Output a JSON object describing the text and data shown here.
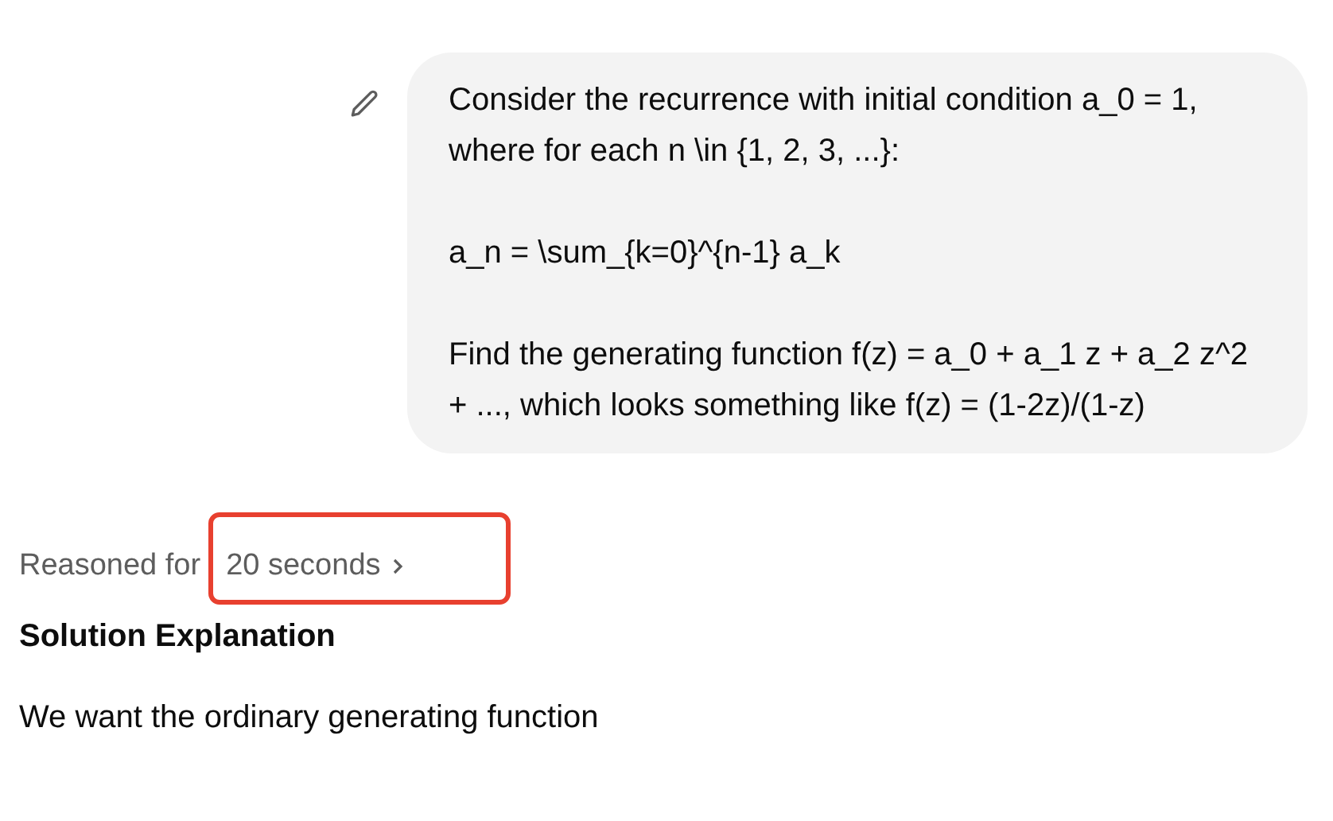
{
  "user_message": {
    "paragraphs": [
      "Consider the recurrence with initial condition a_0 = 1, where for each n \\in {1, 2, 3, ...}:",
      "a_n = \\sum_{k=0}^{n-1} a_k",
      "Find the generating function f(z) = a_0 + a_1 z + a_2 z^2 + ..., which looks something like f(z) = (1-2z)/(1-z)"
    ]
  },
  "reasoning": {
    "label": "Reasoned for",
    "duration": "20 seconds"
  },
  "answer": {
    "heading": "Solution Explanation",
    "body": "We want the ordinary generating function"
  }
}
